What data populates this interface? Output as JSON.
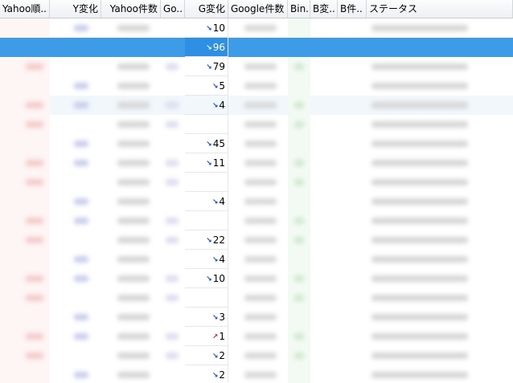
{
  "columns": [
    {
      "label": "Yahoo順..",
      "w": 62,
      "align": "l"
    },
    {
      "label": "Y変化",
      "w": 64,
      "align": "r"
    },
    {
      "label": "Yahoo件数",
      "w": 74,
      "align": "r"
    },
    {
      "label": "Go..",
      "w": 30,
      "align": "l"
    },
    {
      "label": "G変化",
      "w": 54,
      "align": "r"
    },
    {
      "label": "Google件数",
      "w": 74,
      "align": "l"
    },
    {
      "label": "Bin..",
      "w": 28,
      "align": "l"
    },
    {
      "label": "B変..",
      "w": 34,
      "align": "l"
    },
    {
      "label": "B件..",
      "w": 36,
      "align": "l"
    },
    {
      "label": "ステータス",
      "w": 182,
      "align": "l"
    }
  ],
  "colors": {
    "down_arrow": "#1446c8",
    "up_arrow": "#d42a2a",
    "selection": "#3d9be8"
  },
  "rows": [
    {
      "g_change": "10",
      "g_dir": "down"
    },
    {
      "g_change": "96",
      "g_dir": "down",
      "selected": true
    },
    {
      "g_change": "79",
      "g_dir": "down"
    },
    {
      "g_change": "5",
      "g_dir": "down"
    },
    {
      "g_change": "4",
      "g_dir": "down",
      "alt": true
    },
    {
      "g_change": "",
      "g_dir": ""
    },
    {
      "g_change": "45",
      "g_dir": "down"
    },
    {
      "g_change": "11",
      "g_dir": "down"
    },
    {
      "g_change": "",
      "g_dir": ""
    },
    {
      "g_change": "4",
      "g_dir": "down"
    },
    {
      "g_change": "",
      "g_dir": ""
    },
    {
      "g_change": "22",
      "g_dir": "down"
    },
    {
      "g_change": "4",
      "g_dir": "down"
    },
    {
      "g_change": "10",
      "g_dir": "down"
    },
    {
      "g_change": "",
      "g_dir": ""
    },
    {
      "g_change": "3",
      "g_dir": "down"
    },
    {
      "g_change": "1",
      "g_dir": "up"
    },
    {
      "g_change": "2",
      "g_dir": "down"
    },
    {
      "g_change": "2",
      "g_dir": "down"
    }
  ]
}
